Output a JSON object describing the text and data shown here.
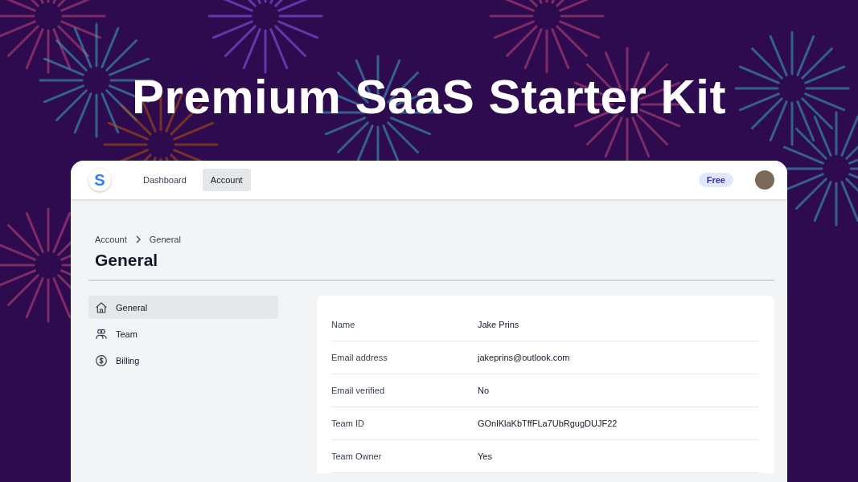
{
  "headline": "Premium SaaS Starter Kit",
  "navbar": {
    "logo": "S",
    "links": [
      {
        "label": "Dashboard",
        "selected": false
      },
      {
        "label": "Account",
        "selected": true
      }
    ],
    "plan_badge": "Free"
  },
  "breadcrumb": [
    "Account",
    "General"
  ],
  "page_title": "General",
  "sidebar": {
    "items": [
      {
        "label": "General",
        "kind": "home",
        "selected": true
      },
      {
        "label": "Team",
        "kind": "users",
        "selected": false
      },
      {
        "label": "Billing",
        "kind": "dollar",
        "selected": false
      }
    ]
  },
  "details": [
    {
      "label": "Name",
      "value": "Jake Prins"
    },
    {
      "label": "Email address",
      "value": "jakeprins@outlook.com"
    },
    {
      "label": "Email verified",
      "value": "No"
    },
    {
      "label": "Team ID",
      "value": "GOnlKlaKbTffFLa7UbRgugDUJF22"
    },
    {
      "label": "Team Owner",
      "value": "Yes"
    }
  ]
}
